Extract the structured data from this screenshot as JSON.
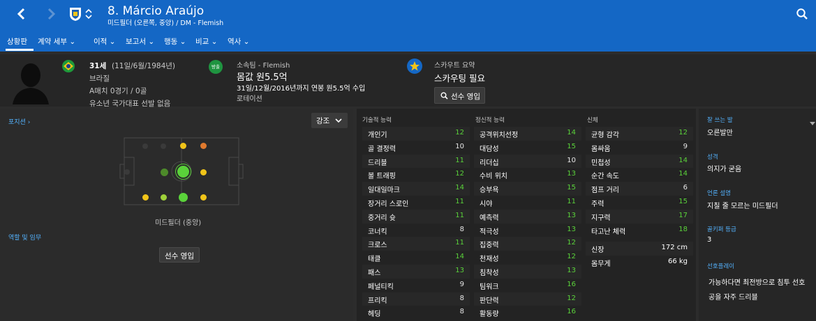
{
  "header": {
    "name": "8. Márcio Araújo",
    "subtitle": "미드필더 (오른쪽, 중앙) / DM - Flemish"
  },
  "tabs": [
    {
      "label": "상황판",
      "active": true
    },
    {
      "label": "계약 세부 ⌄"
    },
    {
      "label": "이적 ⌄"
    },
    {
      "label": "보고서 ⌄"
    },
    {
      "label": "행동 ⌄"
    },
    {
      "label": "비교 ⌄"
    },
    {
      "label": "역사 ⌄"
    }
  ],
  "bio": {
    "age": "31세",
    "dob": "(11일/6월/1984년)",
    "nationality": "브라질",
    "caps": "A매치 0경기 / 0골",
    "youth": "유소년 국가대표 선발 없음"
  },
  "club": {
    "label": "소속팀 - Flemish",
    "value": "몸값 원5.5억",
    "contract": "31일/12월/2016년까지 연봉 원5.5억 수입",
    "status": "로테이션",
    "badge": "방출"
  },
  "scout": {
    "label": "스카우트 요약",
    "value": "스카우팅 필요",
    "button": "선수 영입"
  },
  "left": {
    "positions_label": "포지션 ›",
    "highlight_label": "강조",
    "role_label": "역할 및 임무",
    "position_name": "미드필더 (중앙)",
    "recruit_button": "선수 영입"
  },
  "attr_headers": {
    "technical": "기술적 능력",
    "mental": "정신적 능력",
    "physical": "신체"
  },
  "technical": [
    {
      "name": "개인기",
      "value": "12",
      "color": "g"
    },
    {
      "name": "골 결정력",
      "value": "10",
      "color": "w"
    },
    {
      "name": "드리블",
      "value": "11",
      "color": "g"
    },
    {
      "name": "볼 트래핑",
      "value": "12",
      "color": "g"
    },
    {
      "name": "일대일마크",
      "value": "14",
      "color": "g"
    },
    {
      "name": "장거리 스로인",
      "value": "11",
      "color": "g"
    },
    {
      "name": "중거리 슛",
      "value": "11",
      "color": "g"
    },
    {
      "name": "코너킥",
      "value": "8",
      "color": "w"
    },
    {
      "name": "크로스",
      "value": "11",
      "color": "g"
    },
    {
      "name": "태클",
      "value": "14",
      "color": "g"
    },
    {
      "name": "패스",
      "value": "13",
      "color": "g"
    },
    {
      "name": "페널티킥",
      "value": "9",
      "color": "w"
    },
    {
      "name": "프리킥",
      "value": "8",
      "color": "w"
    },
    {
      "name": "헤딩",
      "value": "8",
      "color": "w"
    }
  ],
  "mental": [
    {
      "name": "공격위치선정",
      "value": "14",
      "color": "g"
    },
    {
      "name": "대담성",
      "value": "15",
      "color": "g"
    },
    {
      "name": "리더십",
      "value": "10",
      "color": "w"
    },
    {
      "name": "수비 위치",
      "value": "13",
      "color": "g"
    },
    {
      "name": "승부욕",
      "value": "15",
      "color": "g"
    },
    {
      "name": "시야",
      "value": "11",
      "color": "g"
    },
    {
      "name": "예측력",
      "value": "13",
      "color": "g"
    },
    {
      "name": "적극성",
      "value": "13",
      "color": "g"
    },
    {
      "name": "집중력",
      "value": "12",
      "color": "g"
    },
    {
      "name": "천재성",
      "value": "12",
      "color": "g"
    },
    {
      "name": "침착성",
      "value": "13",
      "color": "g"
    },
    {
      "name": "팀워크",
      "value": "16",
      "color": "g"
    },
    {
      "name": "판단력",
      "value": "12",
      "color": "g"
    },
    {
      "name": "활동량",
      "value": "16",
      "color": "g"
    }
  ],
  "physical": [
    {
      "name": "균형 감각",
      "value": "12",
      "color": "g"
    },
    {
      "name": "몸싸움",
      "value": "9",
      "color": "w"
    },
    {
      "name": "민첩성",
      "value": "14",
      "color": "g"
    },
    {
      "name": "순간 속도",
      "value": "14",
      "color": "g"
    },
    {
      "name": "점프 거리",
      "value": "6",
      "color": "w"
    },
    {
      "name": "주력",
      "value": "15",
      "color": "g"
    },
    {
      "name": "지구력",
      "value": "17",
      "color": "g"
    },
    {
      "name": "타고난 체력",
      "value": "18",
      "color": "g"
    }
  ],
  "measurements": [
    {
      "name": "신장",
      "value": "172 cm"
    },
    {
      "name": "몸무게",
      "value": "66 kg"
    }
  ],
  "side": {
    "foot_label": "잘 쓰는 발",
    "foot_value": "오른발만",
    "personality_label": "성격",
    "personality_value": "의지가 굳음",
    "media_label": "언론 설명",
    "media_value": "지칠 줄 모르는 미드필더",
    "gk_label": "골키퍼 등급",
    "gk_value": "3",
    "prefs_label": "선호플레이",
    "prefs": [
      "가능하다면 최전방으로 침투 선호",
      "공을 자주 드리블"
    ]
  },
  "colors": {
    "accent": "#1467c5",
    "good": "#5ad23a",
    "natural": "#f0c419",
    "label_blue": "#54b3ff"
  }
}
